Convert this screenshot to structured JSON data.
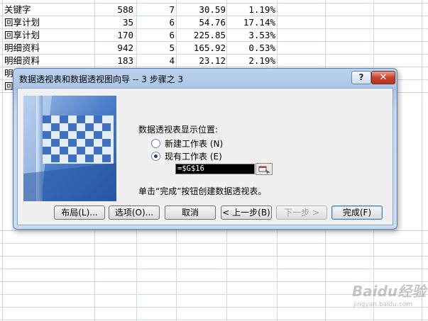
{
  "sheet": {
    "rows": [
      {
        "name": "关键字",
        "count": "588",
        "num": "7",
        "value": "30.59",
        "pct": "1.19%"
      },
      {
        "name": "回享计划",
        "count": "35",
        "num": "6",
        "value": "54.76",
        "pct": "17.14%"
      },
      {
        "name": "回享计划",
        "count": "170",
        "num": "6",
        "value": "225.85",
        "pct": "3.53%"
      },
      {
        "name": "明细资料",
        "count": "942",
        "num": "5",
        "value": "165.92",
        "pct": "0.53%"
      },
      {
        "name": "明细资料",
        "count": "183",
        "num": "4",
        "value": "23.12",
        "pct": "2.19%"
      }
    ],
    "partial_rows": [
      {
        "name": "明",
        "count": "",
        "num": "",
        "value": "",
        "pct": ""
      },
      {
        "name": "回",
        "count": "",
        "num": "",
        "value": "",
        "pct": ""
      }
    ]
  },
  "dialog": {
    "title": "数据透视表和数据透视图向导 -- 3 步骤之 3",
    "help_label": "?",
    "close_label": "✕",
    "location_prompt": "数据透视表显示位置:",
    "options": [
      {
        "label": "新建工作表 (N)",
        "selected": false
      },
      {
        "label": "现有工作表 (E)",
        "selected": true
      }
    ],
    "reference_value": "=$G$16",
    "hint": "单击“完成”按钮创建数据透视表。",
    "buttons": {
      "layout": "布局(L)...",
      "options": "选项(O)...",
      "cancel": "取消",
      "back": "< 上一步(B)",
      "next": "下一步 >",
      "finish": "完成(F)"
    }
  },
  "watermark": {
    "brand": "Baidu经验",
    "url": "jingyan.baidu.com"
  },
  "colors": {
    "accent": "#3c6fbd",
    "title_bar": "#bcd3ee",
    "close": "#c8412b"
  }
}
